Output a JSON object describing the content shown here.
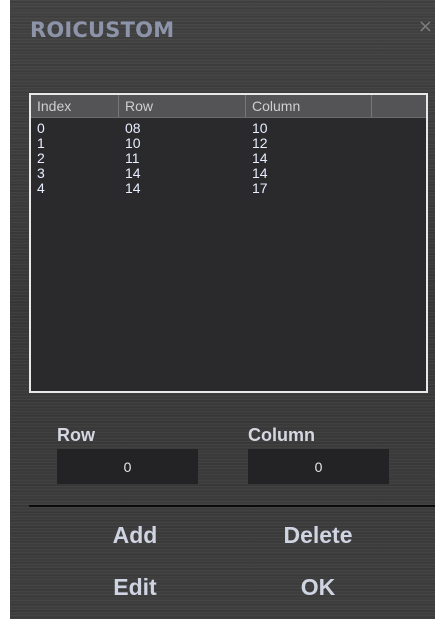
{
  "window": {
    "title": "ROICUSTOM",
    "close_glyph": "×"
  },
  "list": {
    "columns": [
      "Index",
      "Row",
      "Column",
      ""
    ],
    "rows": [
      [
        "0",
        "08",
        "10"
      ],
      [
        "1",
        "10",
        "12"
      ],
      [
        "2",
        "11",
        "14"
      ],
      [
        "3",
        "14",
        "14"
      ],
      [
        "4",
        "14",
        "17"
      ]
    ]
  },
  "fields": {
    "row_label": "Row",
    "row_value": "0",
    "column_label": "Column",
    "column_value": "0"
  },
  "buttons": {
    "add": "Add",
    "delete": "Delete",
    "edit": "Edit",
    "ok": "OK"
  },
  "colors": {
    "title": "#8d93a9",
    "panel_background": "#3b3b3b",
    "list_background": "#2a2a2c",
    "list_text": "#e8eeff"
  }
}
